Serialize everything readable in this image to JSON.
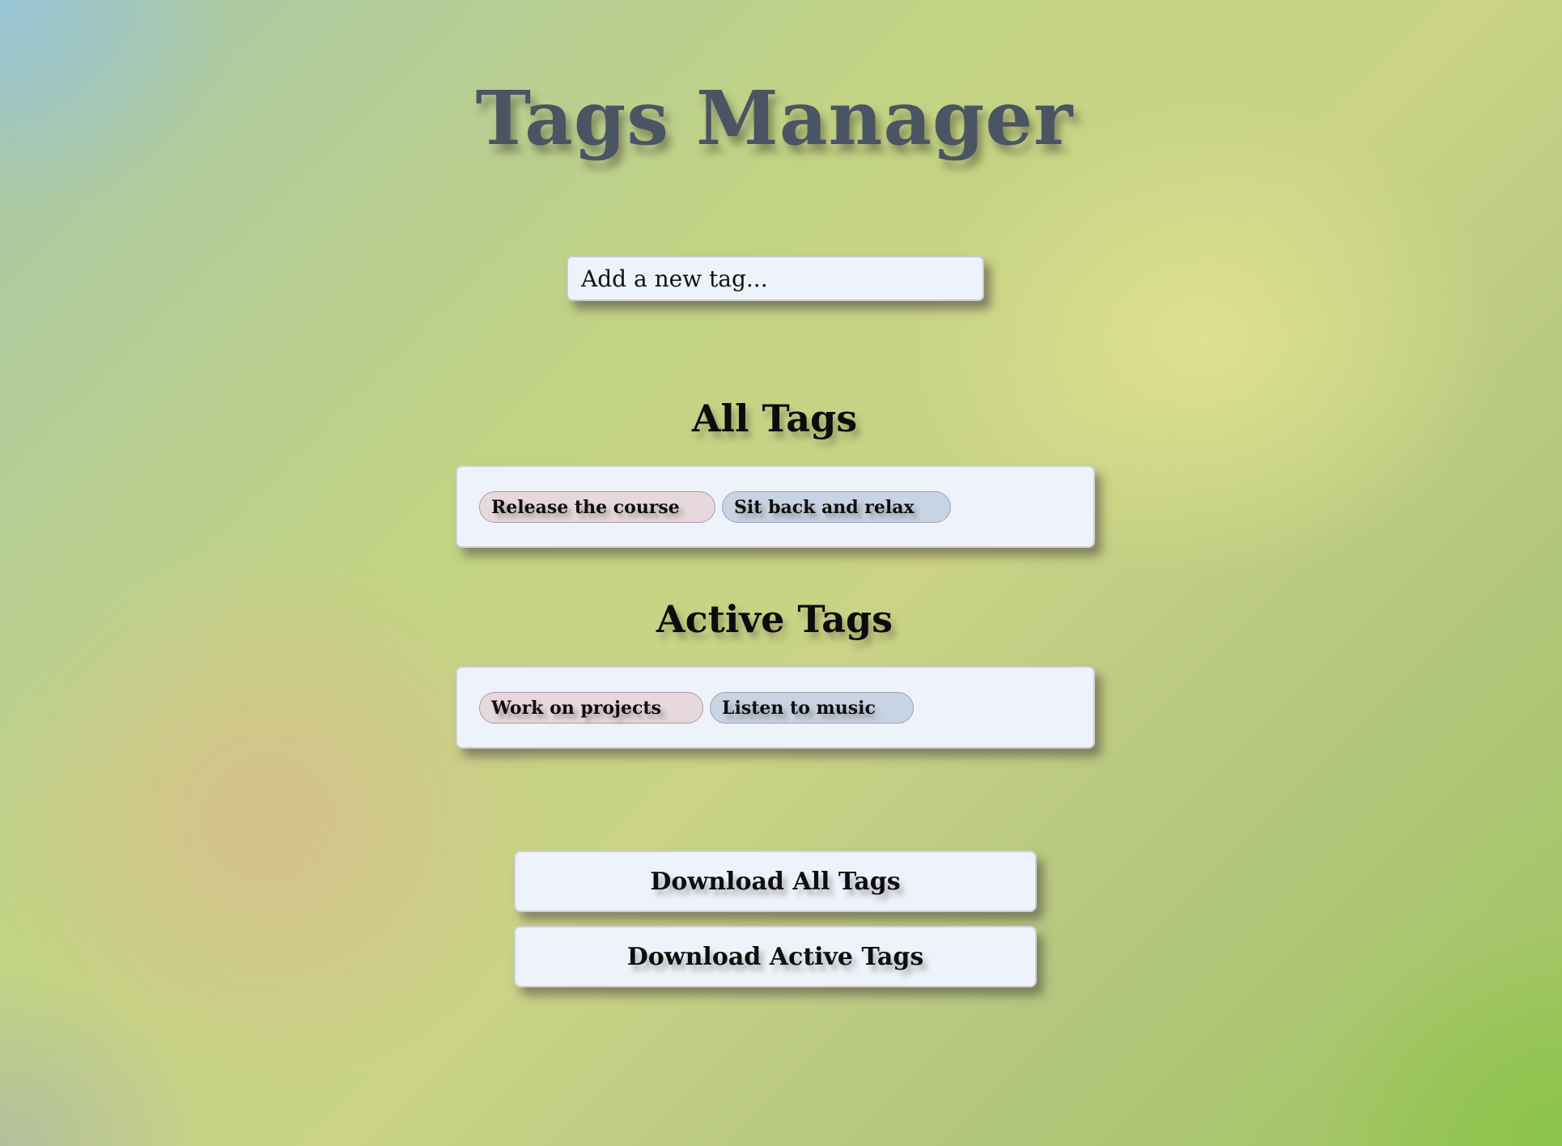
{
  "header": {
    "title": "Tags Manager"
  },
  "input": {
    "placeholder": "Add a new tag...",
    "value": ""
  },
  "all_tags": {
    "heading": "All Tags",
    "tags": [
      {
        "label": "Release the course",
        "color": "#e6d8dc"
      },
      {
        "label": "Sit back and relax",
        "color": "#c8d3e3"
      }
    ]
  },
  "active_tags": {
    "heading": "Active Tags",
    "tags": [
      {
        "label": "Work on projects",
        "color": "#e6d8dc"
      },
      {
        "label": "Listen to music",
        "color": "#c8d3e3"
      }
    ]
  },
  "actions": {
    "download_all_label": "Download All Tags",
    "download_active_label": "Download Active Tags"
  },
  "colors": {
    "title": "#4b5463",
    "panel": "#eef3fb",
    "tag_pink": "#e6d8dc",
    "tag_blue": "#c8d3e3"
  }
}
